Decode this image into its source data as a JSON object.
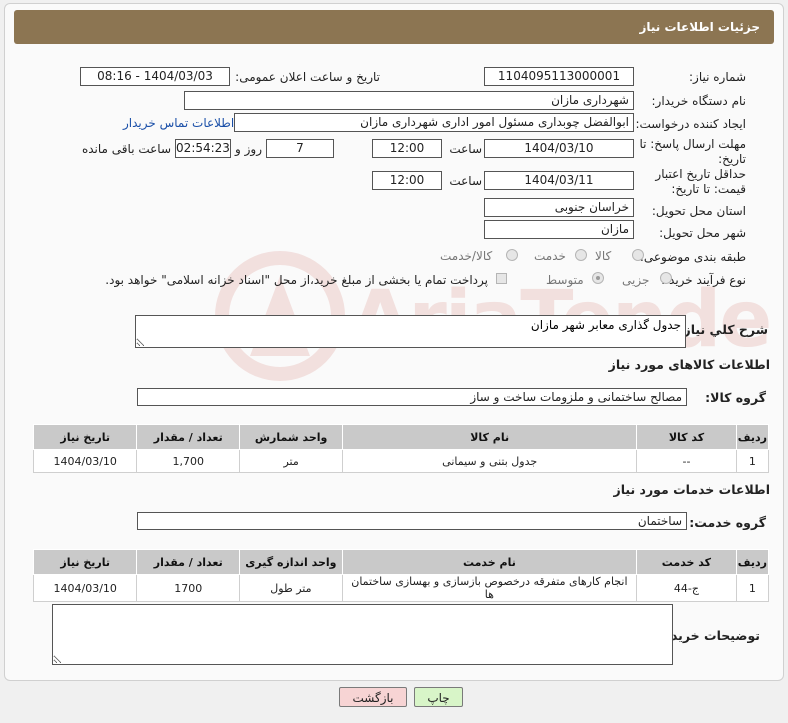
{
  "header": {
    "title": "جزئیات اطلاعات نیاز"
  },
  "form": {
    "need_number_label": "شماره نیاز:",
    "need_number": "1104095113000001",
    "announce_label": "تاریخ و ساعت اعلان عمومی:",
    "announce_value": "1404/03/03 - 08:16",
    "buyer_org_label": "نام دستگاه خریدار:",
    "buyer_org": "شهرداری مازان",
    "creator_label": "ایجاد کننده درخواست:",
    "creator": "ابوالفضل چوبداری مسئول امور اداری شهرداری مازان",
    "contact_link": "اطلاعات تماس خریدار",
    "reply_deadline_label": "مهلت ارسال پاسخ: تا تاریخ:",
    "reply_date": "1404/03/10",
    "time_label": "ساعت",
    "reply_time": "12:00",
    "days_value": "7",
    "days_label": "روز و",
    "remaining_time": "02:54:23",
    "remaining_label": "ساعت باقی مانده",
    "price_validity_label": "حداقل تاریخ اعتبار قیمت: تا تاریخ:",
    "price_date": "1404/03/11",
    "price_time": "12:00",
    "province_label": "استان محل تحویل:",
    "province": "خراسان جنوبی",
    "city_label": "شهر محل تحویل:",
    "city": "مازان",
    "category_label": "طبقه بندی موضوعی:",
    "category_options": [
      "کالا",
      "خدمت",
      "کالا/خدمت"
    ],
    "process_label": "نوع فرآیند خرید :",
    "process_options": [
      "جزیی",
      "متوسط"
    ],
    "payment_note": "پرداخت تمام یا بخشی از مبلغ خرید،از محل \"اسناد خزانه اسلامی\" خواهد بود."
  },
  "summary": {
    "label": "شرح کلي نياز:",
    "value": "جدول گذاری معابر شهر مازان"
  },
  "goods": {
    "section_title": "اطلاعات کالاهای مورد نیاز",
    "group_label": "گروه کالا:",
    "group_value": "مصالح ساختمانی و ملزومات ساخت و ساز",
    "columns": [
      "ردیف",
      "کد کالا",
      "نام کالا",
      "واحد شمارش",
      "تعداد / مقدار",
      "تاریخ نیاز"
    ],
    "rows": [
      [
        "1",
        "--",
        "جدول بتنی و سیمانی",
        "متر",
        "1,700",
        "1404/03/10"
      ]
    ]
  },
  "services": {
    "section_title": "اطلاعات خدمات مورد نیاز",
    "group_label": "گروه خدمت:",
    "group_value": "ساختمان",
    "columns": [
      "ردیف",
      "کد خدمت",
      "نام خدمت",
      "واحد اندازه گیری",
      "تعداد / مقدار",
      "تاریخ نیاز"
    ],
    "rows": [
      [
        "1",
        "ج-44",
        "انجام کارهای متفرقه درخصوص بازسازی و بهسازی ساختمان ها",
        "متر طول",
        "1700",
        "1404/03/10"
      ]
    ]
  },
  "buyer_notes": {
    "label": "توضیحات خریدار:",
    "value": ""
  },
  "buttons": {
    "print": "چاپ",
    "back": "بازگشت"
  },
  "watermark": {
    "text": "AriaTender.neT"
  },
  "colors": {
    "header_bg": "#8c7552",
    "link": "#1a4fa8",
    "back_button_bg": "#f7d4d4",
    "print_button_bg": "#d8f5c8"
  }
}
